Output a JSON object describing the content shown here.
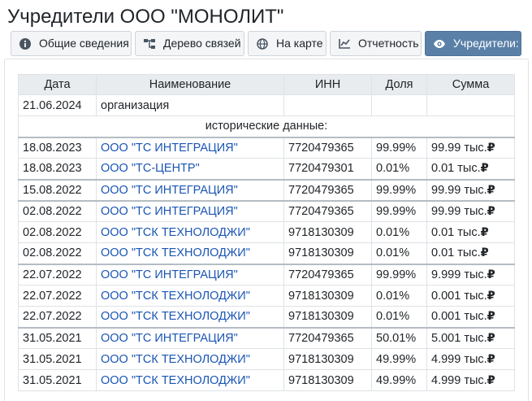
{
  "page": {
    "title": "Учредители ООО \"МОНОЛИТ\""
  },
  "tabs": [
    {
      "label": "Общие сведения",
      "icon": "info-circle-icon",
      "active": false
    },
    {
      "label": "Дерево связей",
      "icon": "sitemap-icon",
      "active": false
    },
    {
      "label": "На карте",
      "icon": "globe-icon",
      "active": false
    },
    {
      "label": "Отчетность",
      "icon": "line-chart-icon",
      "active": false
    },
    {
      "label": "Учредители:",
      "icon": "eye-icon",
      "active": true
    }
  ],
  "table": {
    "headers": [
      "Дата",
      "Наименование",
      "ИНН",
      "Доля",
      "Сумма"
    ],
    "current_row": {
      "date": "21.06.2024",
      "name": "организация",
      "inn": "",
      "share": "",
      "sum": ""
    },
    "history_label": "исторические данные:",
    "currency_symbol": "₽",
    "rows": [
      {
        "date": "18.08.2023",
        "name": "ООО \"ТС ИНТЕГРАЦИЯ\"",
        "inn": "7720479365",
        "share": "99.99%",
        "sum": "99.99 тыс.",
        "group_start": true
      },
      {
        "date": "18.08.2023",
        "name": "ООО \"ТС-ЦЕНТР\"",
        "inn": "7720479301",
        "share": "0.01%",
        "sum": "0.01 тыс.",
        "group_start": false
      },
      {
        "date": "15.08.2022",
        "name": "ООО \"ТС ИНТЕГРАЦИЯ\"",
        "inn": "7720479365",
        "share": "99.99%",
        "sum": "99.99 тыс.",
        "group_start": true
      },
      {
        "date": "02.08.2022",
        "name": "ООО \"ТС ИНТЕГРАЦИЯ\"",
        "inn": "7720479365",
        "share": "99.99%",
        "sum": "99.99 тыс.",
        "group_start": true
      },
      {
        "date": "02.08.2022",
        "name": "ООО \"ТСК ТЕХНОЛОДЖИ\"",
        "inn": "9718130309",
        "share": "0.01%",
        "sum": "0.01 тыс.",
        "group_start": false
      },
      {
        "date": "02.08.2022",
        "name": "ООО \"ТСК ТЕХНОЛОДЖИ\"",
        "inn": "9718130309",
        "share": "0.01%",
        "sum": "0.01 тыс.",
        "group_start": false
      },
      {
        "date": "22.07.2022",
        "name": "ООО \"ТС ИНТЕГРАЦИЯ\"",
        "inn": "7720479365",
        "share": "99.99%",
        "sum": "9.999 тыс.",
        "group_start": true
      },
      {
        "date": "22.07.2022",
        "name": "ООО \"ТСК ТЕХНОЛОДЖИ\"",
        "inn": "9718130309",
        "share": "0.01%",
        "sum": "0.001 тыс.",
        "group_start": false
      },
      {
        "date": "22.07.2022",
        "name": "ООО \"ТСК ТЕХНОЛОДЖИ\"",
        "inn": "9718130309",
        "share": "0.01%",
        "sum": "0.001 тыс.",
        "group_start": false
      },
      {
        "date": "31.05.2021",
        "name": "ООО \"ТС ИНТЕГРАЦИЯ\"",
        "inn": "7720479365",
        "share": "50.01%",
        "sum": "5.001 тыс.",
        "group_start": true
      },
      {
        "date": "31.05.2021",
        "name": "ООО \"ТСК ТЕХНОЛОДЖИ\"",
        "inn": "9718130309",
        "share": "49.99%",
        "sum": "4.999 тыс.",
        "group_start": false
      },
      {
        "date": "31.05.2021",
        "name": "ООО \"ТСК ТЕХНОЛОДЖИ\"",
        "inn": "9718130309",
        "share": "49.99%",
        "sum": "4.999 тыс.",
        "group_start": false
      }
    ]
  }
}
